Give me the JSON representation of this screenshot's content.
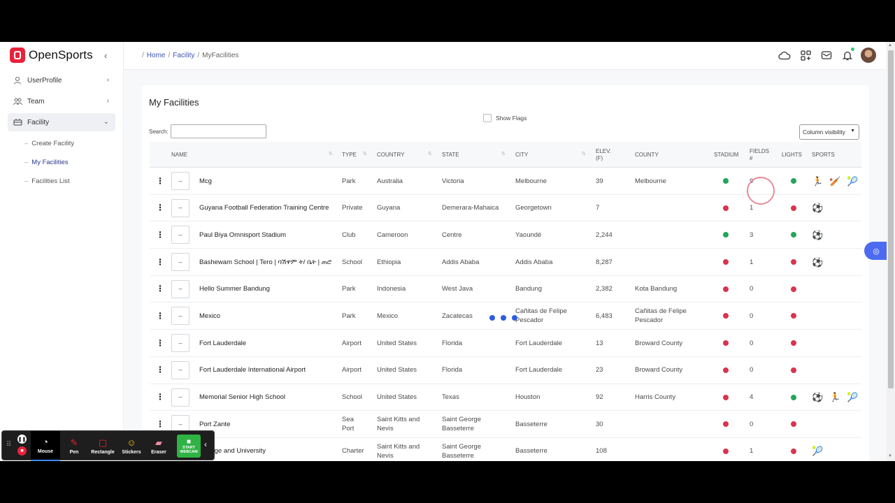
{
  "app": {
    "name": "OpenSports"
  },
  "sidebar": {
    "items": [
      {
        "label": "UserProfile",
        "icon": "user-icon"
      },
      {
        "label": "Team",
        "icon": "team-icon"
      },
      {
        "label": "Facility",
        "icon": "stadium-icon"
      }
    ],
    "sub_items": [
      {
        "label": "Create Facility"
      },
      {
        "label": "My Facilities"
      },
      {
        "label": "Facilities List"
      }
    ]
  },
  "breadcrumb": {
    "home": "Home",
    "facility": "Facility",
    "current": "MyFacilities"
  },
  "page": {
    "title": "My Facilities",
    "show_flags_label": "Show Flags",
    "search_label": "Search:",
    "column_visibility": "Column visibility"
  },
  "table": {
    "headers": {
      "name": "NAME",
      "type": "TYPE",
      "country": "COUNTRY",
      "state": "STATE",
      "city": "CITY",
      "elev": "ELEV. (F)",
      "county": "COUNTY",
      "stadium": "STADIUM",
      "fields": "FIELDS #",
      "lights": "LIGHTS",
      "sports": "SPORTS"
    },
    "flag_placeholder": "–",
    "rows": [
      {
        "name": "Mcg",
        "type": "Park",
        "country": "Australia",
        "state": "Victoria",
        "city": "Melbourne",
        "elev": "39",
        "county": "Melbourne",
        "stadium": "green",
        "fields": "9",
        "lights": "green",
        "sports": [
          "🏃",
          "🏏",
          "🎾"
        ]
      },
      {
        "name": "Guyana Football Federation Training Centre",
        "type": "Private",
        "country": "Guyana",
        "state": "Demerara-Mahaica",
        "city": "Georgetown",
        "elev": "7",
        "county": "",
        "stadium": "red",
        "fields": "1",
        "lights": "red",
        "sports": [
          "⚽"
        ]
      },
      {
        "name": "Paul Biya Omnisport Stadium",
        "type": "Club",
        "country": "Cameroon",
        "state": "Centre",
        "city": "Yaoundé",
        "elev": "2,244",
        "county": "",
        "stadium": "green",
        "fields": "3",
        "lights": "green",
        "sports": [
          "⚽"
        ]
      },
      {
        "name": "Bashewam School | Tero | ባሽዋም ት/ ቤት | ጠሮ",
        "type": "School",
        "country": "Ethiopia",
        "state": "Addis Ababa",
        "city": "Addis Ababa",
        "elev": "8,287",
        "county": "",
        "stadium": "red",
        "fields": "1",
        "lights": "red",
        "sports": [
          "⚽"
        ]
      },
      {
        "name": "Hello Summer Bandung",
        "type": "Park",
        "country": "Indonesia",
        "state": "West Java",
        "city": "Bandung",
        "elev": "2,382",
        "county": "Kota Bandung",
        "stadium": "red",
        "fields": "0",
        "lights": "red",
        "sports": []
      },
      {
        "name": "Mexico",
        "type": "Park",
        "country": "Mexico",
        "state": "Zacatecas",
        "city": "Cañitas de Felipe Pescador",
        "elev": "6,483",
        "county": "Cañitas de Felipe Pescador",
        "stadium": "red",
        "fields": "0",
        "lights": "red",
        "sports": []
      },
      {
        "name": "Fort Lauderdale",
        "type": "Airport",
        "country": "United States",
        "state": "Florida",
        "city": "Fort Lauderdale",
        "elev": "13",
        "county": "Broward County",
        "stadium": "red",
        "fields": "0",
        "lights": "red",
        "sports": []
      },
      {
        "name": "Fort Lauderdale International Airport",
        "type": "Airport",
        "country": "United States",
        "state": "Florida",
        "city": "Fort Lauderdale",
        "elev": "23",
        "county": "Broward County",
        "stadium": "red",
        "fields": "0",
        "lights": "red",
        "sports": []
      },
      {
        "name": "Memorial Senior High School",
        "type": "School",
        "country": "United States",
        "state": "Texas",
        "city": "Houston",
        "elev": "92",
        "county": "Harris County",
        "stadium": "red",
        "fields": "4",
        "lights": "green",
        "sports": [
          "⚽",
          "🏃",
          "🎾"
        ]
      },
      {
        "name": "Port Zante",
        "type": "Sea Port",
        "country": "Saint Kitts and Nevis",
        "state": "Saint George Basseterre",
        "city": "Basseterre",
        "elev": "30",
        "county": "",
        "stadium": "red",
        "fields": "0",
        "lights": "red",
        "sports": []
      },
      {
        "name": "College and University",
        "type": "Charter",
        "country": "Saint Kitts and Nevis",
        "state": "Saint George Basseterre",
        "city": "Basseterre",
        "elev": "108",
        "county": "",
        "stadium": "red",
        "fields": "1",
        "lights": "red",
        "sports": [
          "🎾"
        ]
      }
    ]
  },
  "colors": {
    "green": "#23a55a",
    "red": "#d8344f",
    "accent": "#3c55b5"
  },
  "recorder": {
    "tools": [
      {
        "label": "Mouse",
        "icon": "mouse-icon"
      },
      {
        "label": "Pen",
        "icon": "pen-icon"
      },
      {
        "label": "Rectangle",
        "icon": "rectangle-icon"
      },
      {
        "label": "Stickers",
        "icon": "sticker-icon"
      },
      {
        "label": "Eraser",
        "icon": "eraser-icon"
      }
    ],
    "webcam": "START WEBCAM"
  }
}
